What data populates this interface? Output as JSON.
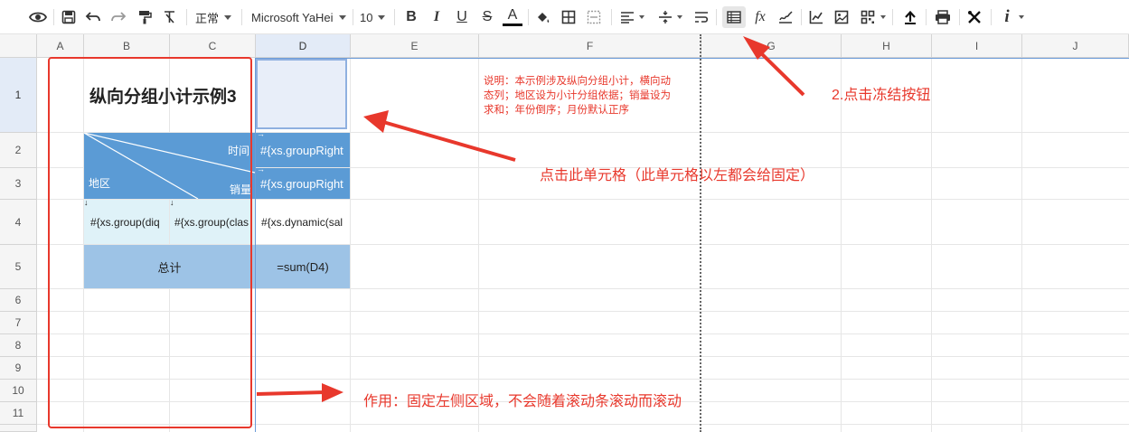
{
  "toolbar": {
    "style_select": "正常",
    "font_select": "Microsoft YaHei",
    "size_select": "10",
    "icons": [
      "eye-icon",
      "save-icon",
      "undo-icon",
      "redo-icon",
      "format-painter-icon",
      "clear-format-icon",
      "bold-icon",
      "italic-icon",
      "underline-icon",
      "strikethrough-icon",
      "font-color-icon",
      "fill-color-icon",
      "border-icon",
      "merge-cells-icon",
      "align-icon",
      "valign-icon",
      "wrap-icon",
      "freeze-icon",
      "function-icon",
      "sign-icon",
      "chart-icon",
      "image-icon",
      "qrcode-icon",
      "upload-icon",
      "print-icon",
      "tools-icon",
      "info-icon"
    ],
    "bold_glyph": "B",
    "italic_glyph": "I",
    "underline_glyph": "U",
    "strike_glyph": "S",
    "fontcolor_glyph": "A",
    "fx_glyph": "fx",
    "info_glyph": "i"
  },
  "columns": [
    "A",
    "B",
    "C",
    "D",
    "E",
    "F",
    "G",
    "H",
    "I",
    "J"
  ],
  "rows": [
    "1",
    "2",
    "3",
    "4",
    "5",
    "6",
    "7",
    "8",
    "9",
    "10",
    "11"
  ],
  "cells": {
    "b1": "纵向分组小计示例3",
    "header_time": "时间",
    "header_region": "地区",
    "header_sales": "销量",
    "d2": "#{xs.groupRight",
    "d3": "#{xs.groupRight",
    "b4": "#{xs.group(diq",
    "c4": "#{xs.group(clas",
    "d4": "#{xs.dynamic(sal",
    "b5": "总计",
    "d5": "=sum(D4)"
  },
  "notes": {
    "description": [
      "说明：本示例涉及纵向分组小计，横向动",
      "态列；地区设为小计分组依据；销量设为",
      "求和；年份倒序；月份默认正序"
    ],
    "step2": "2.点击冻结按钮",
    "click_cell": "点击此单元格（此单元格以左都会给固定）",
    "effect": "作用：固定左侧区域，不会随着滚动条滚动而滚动"
  },
  "colors": {
    "accent_red": "#e8382c",
    "header_blue": "#5b9bd5",
    "light_cyan": "#dff2f8",
    "total_blue": "#9dc3e6",
    "selected_cell": "#e8eef9",
    "freeze_line": "#6b9bd8"
  }
}
